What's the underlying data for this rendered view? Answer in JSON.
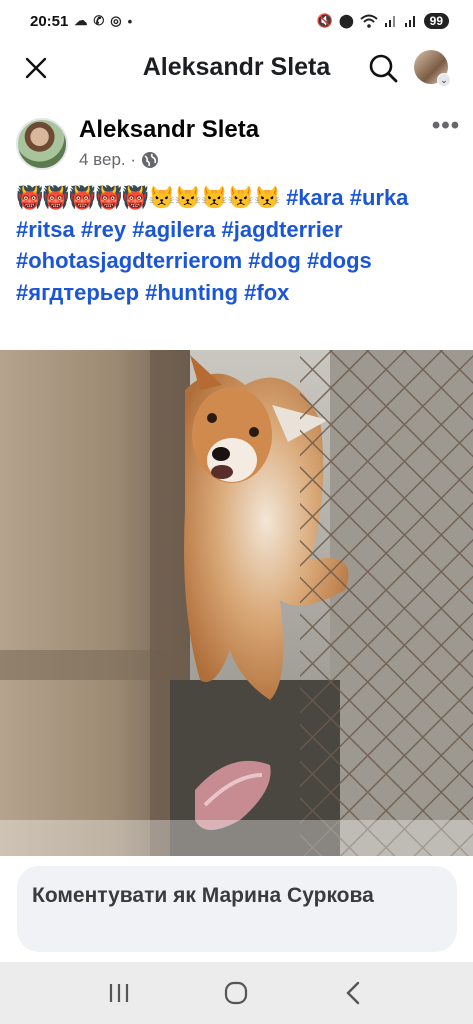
{
  "status_bar": {
    "time": "20:51",
    "battery": "99",
    "left_icons": [
      "cloud-icon",
      "viber-icon",
      "location-ring-icon",
      "dot-icon"
    ],
    "right_icons": [
      "mute-icon",
      "location-icon",
      "wifi-icon",
      "signal-icon",
      "signal-icon"
    ]
  },
  "topbar": {
    "title": "Aleksandr  Sleta"
  },
  "post": {
    "author": "Aleksandr  Sleta",
    "time": "4 вер. ·",
    "privacy_icon": "globe-icon",
    "more_label": "•••",
    "emojis": "👹👹👹👹👹😾😾😾😾😾",
    "hashtags": [
      "#kara",
      "#urka",
      "#ritsa",
      "#rey",
      "#agilera",
      "#jagdterrier",
      "#ohotasjagdterrierom",
      "#dog",
      "#dogs",
      "#ягдтерьер",
      "#hunting",
      "#fox"
    ],
    "photo_alt": "fox-photo"
  },
  "comment": {
    "placeholder": "Коментувати як Марина Суркова"
  },
  "colors": {
    "hashtag": "#1a56d6",
    "navbar_bg": "#ececec",
    "comment_bg": "#f0f2f5"
  }
}
